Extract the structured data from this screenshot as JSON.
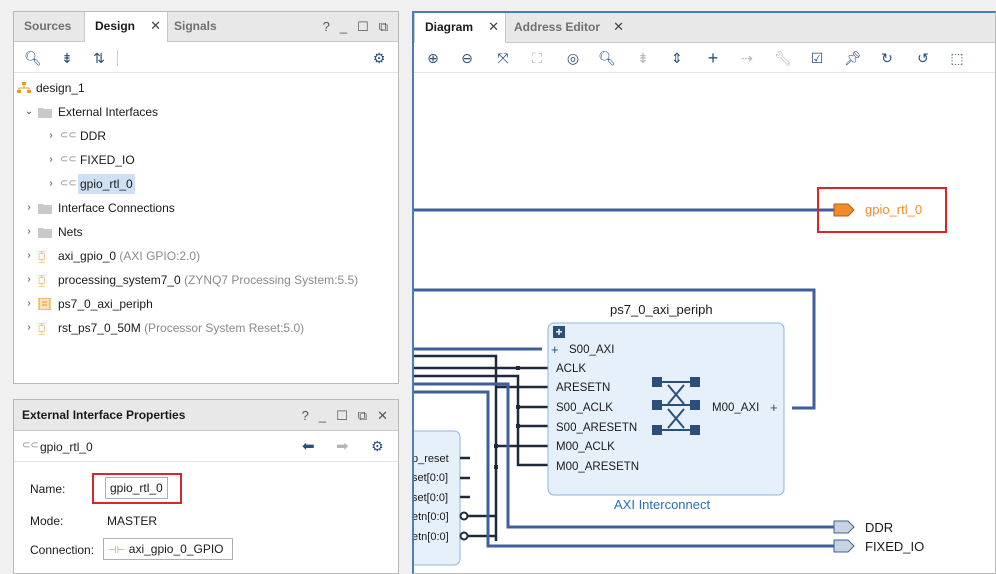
{
  "design_panel": {
    "tabs": [
      "Sources",
      "Design",
      "Signals"
    ],
    "tree": {
      "root": "design_1",
      "external_interfaces": "External Interfaces",
      "ei_children": [
        "DDR",
        "FIXED_IO",
        "gpio_rtl_0"
      ],
      "interface_connections": "Interface Connections",
      "nets": "Nets",
      "axi_gpio": "axi_gpio_0",
      "axi_gpio_type": "(AXI GPIO:2.0)",
      "ps7": "processing_system7_0",
      "ps7_type": "(ZYNQ7 Processing System:5.5)",
      "periph": "ps7_0_axi_periph",
      "rst": "rst_ps7_0_50M",
      "rst_type": "(Processor System Reset:5.0)"
    }
  },
  "props_panel": {
    "title": "External Interface Properties",
    "object_name": "gpio_rtl_0",
    "name_label": "Name:",
    "name_value": "gpio_rtl_0",
    "mode_label": "Mode:",
    "mode_value": "MASTER",
    "connection_label": "Connection:",
    "connection_value": "axi_gpio_0_GPIO"
  },
  "diagram_panel": {
    "tabs": [
      "Diagram",
      "Address Editor"
    ],
    "ports": {
      "gpio": "gpio_rtl_0",
      "ddr": "DDR",
      "fixed_io": "FIXED_IO"
    },
    "interconnect": {
      "instance": "ps7_0_axi_periph",
      "type": "AXI Interconnect",
      "pins_left": [
        "S00_AXI",
        "ACLK",
        "ARESETN",
        "S00_ACLK",
        "S00_ARESETN",
        "M00_ACLK",
        "M00_ARESETN"
      ],
      "pin_right": "M00_AXI"
    },
    "reset_block_pins": [
      "p_reset",
      "set[0:0]",
      "set[0:0]",
      "etn[0:0]",
      "etn[0:0]"
    ]
  },
  "colors": {
    "wire_blue": "#3f5f9c",
    "wire_dark": "#1e2a3a",
    "port_orange": "#f28c28",
    "highlight_red": "#d9262a",
    "block_fill": "#e6f0fa"
  }
}
